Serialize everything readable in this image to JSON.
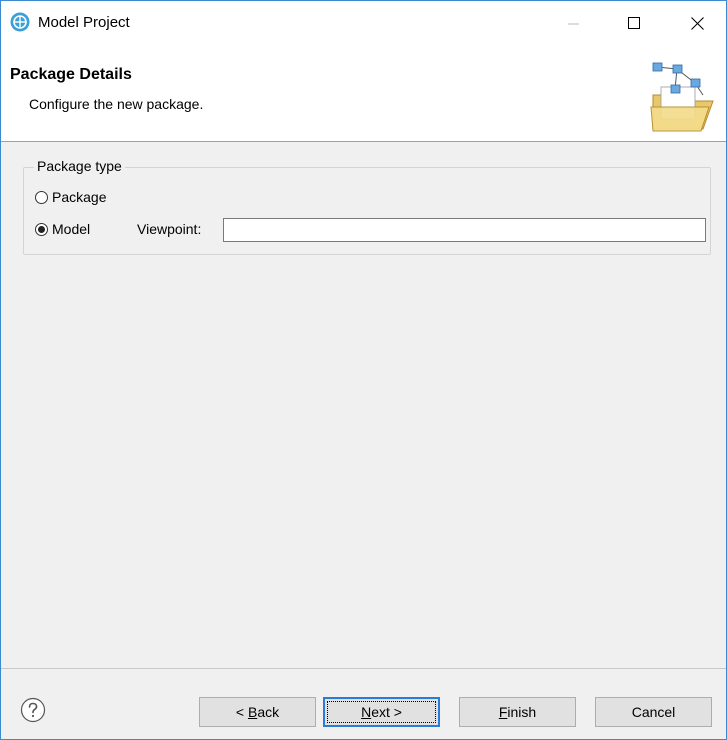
{
  "window": {
    "title": "Model Project"
  },
  "banner": {
    "title": "Package Details",
    "description": "Configure the new package."
  },
  "package_type": {
    "legend": "Package type",
    "options": [
      {
        "label": "Package",
        "checked": false
      },
      {
        "label": "Model",
        "checked": true
      }
    ],
    "viewpoint_label": "Viewpoint:",
    "viewpoint_value": ""
  },
  "buttons": {
    "back": {
      "prefix": "< ",
      "mnemonic": "B",
      "rest": "ack"
    },
    "next": {
      "mnemonic": "N",
      "rest": "ext >"
    },
    "finish": {
      "mnemonic": "F",
      "rest": "inish"
    },
    "cancel": "Cancel"
  },
  "colors": {
    "accent": "#2a7cd6",
    "background": "#f0f0f0"
  }
}
